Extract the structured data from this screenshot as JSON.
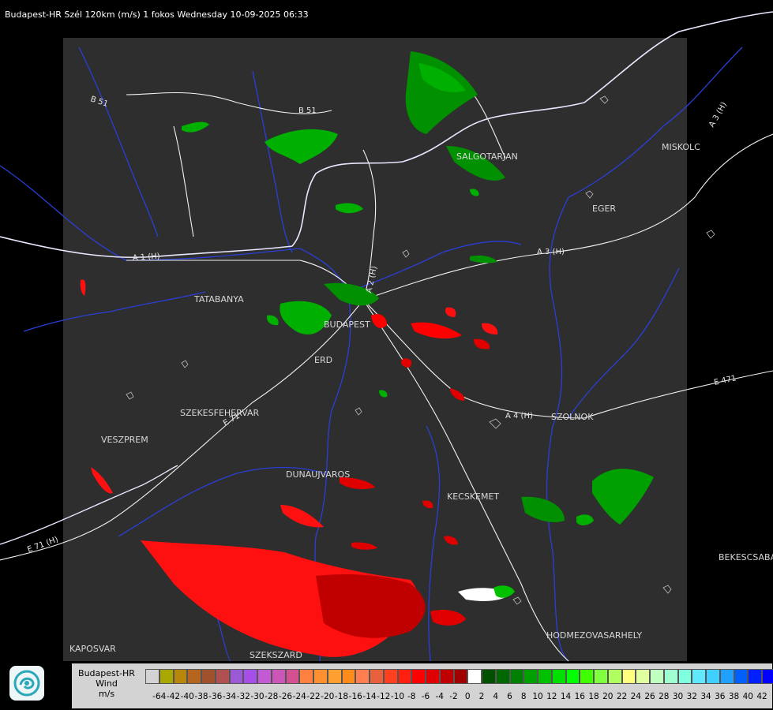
{
  "header": {
    "title": "Budapest-HR Szél 120km (m/s) 1 fokos Wednesday 10-09-2025 06:33"
  },
  "map": {
    "cities": [
      "SALGOTARJAN",
      "MISKOLC",
      "EGER",
      "TATABANYA",
      "BUDAPEST",
      "ERD",
      "SZEKESFEHERVAR",
      "VESZPREM",
      "DUNAUJVAROS",
      "KECSKEMET",
      "SZOLNOK",
      "BEKESCSABA",
      "HODMEZOVASARHELY",
      "KAPOSVAR",
      "SZEKSZARD"
    ],
    "roads": [
      "B 51",
      "B 51",
      "A 3 (H)",
      "A 3 (H)",
      "A 1 (H)",
      "A 2 (H)",
      "A 4 (H)",
      "E 71",
      "E 71 (H)",
      "E 471"
    ]
  },
  "legend": {
    "title_lines": [
      "Budapest-HR",
      "Wind",
      "m/s"
    ],
    "ticks": [
      "-64",
      "-42",
      "-40",
      "-38",
      "-36",
      "-34",
      "-32",
      "-30",
      "-28",
      "-26",
      "-24",
      "-22",
      "-20",
      "-18",
      "-16",
      "-14",
      "-12",
      "-10",
      "-8",
      "-6",
      "-4",
      "-2",
      "0",
      "2",
      "4",
      "6",
      "8",
      "10",
      "12",
      "14",
      "16",
      "18",
      "20",
      "22",
      "24",
      "26",
      "28",
      "30",
      "32",
      "34",
      "36",
      "38",
      "40",
      "42"
    ],
    "colors": [
      "#d3d3d3",
      "#a8a800",
      "#b8860b",
      "#b5651d",
      "#a0522d",
      "#b05050",
      "#9b59d6",
      "#a64ee8",
      "#c25bd3",
      "#cc55b8",
      "#d45090",
      "#ff8040",
      "#ff9030",
      "#ffa030",
      "#ff8c1a",
      "#ff7f50",
      "#e8603c",
      "#ff4020",
      "#ff2010",
      "#ff0000",
      "#e00000",
      "#c00000",
      "#a00000",
      "#ffffff",
      "#005000",
      "#006800",
      "#008000",
      "#00a000",
      "#00c000",
      "#00e000",
      "#00ff00",
      "#40ff00",
      "#80ff40",
      "#b0ff60",
      "#ffff80",
      "#e0ffa0",
      "#c0ffc0",
      "#a0ffd0",
      "#80ffe0",
      "#60e8ff",
      "#40d0ff",
      "#20a0ff",
      "#0060ff",
      "#0020ff",
      "#0000ff"
    ]
  }
}
